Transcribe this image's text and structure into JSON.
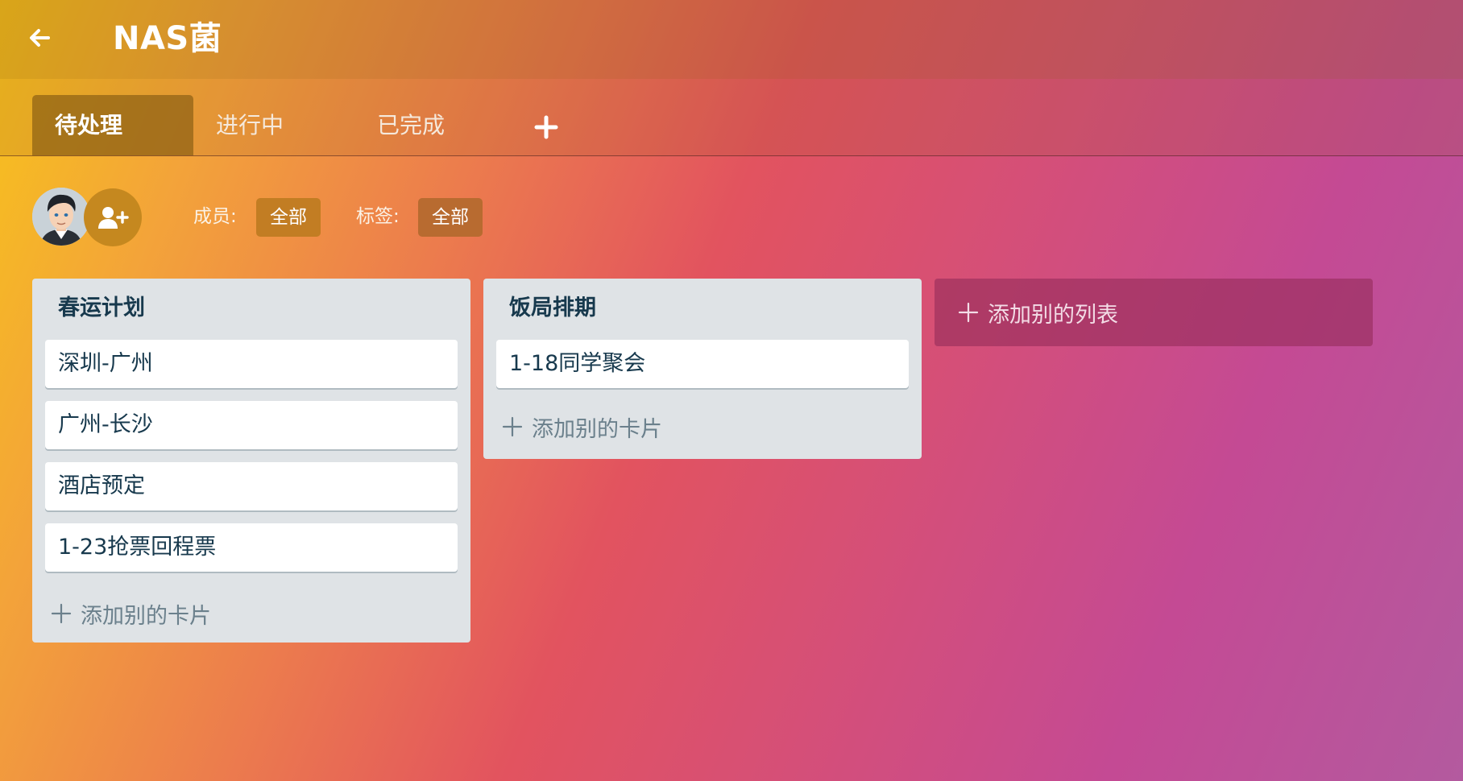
{
  "header": {
    "back_icon": "arrow-left-icon",
    "title": "NAS菌"
  },
  "tabs": [
    {
      "label": "待处理",
      "active": true
    },
    {
      "label": "进行中",
      "active": false
    },
    {
      "label": "已完成",
      "active": false
    }
  ],
  "tab_add_icon": "plus-icon",
  "filters": {
    "members_label": "成员:",
    "members_value": "全部",
    "tags_label": "标签:",
    "tags_value": "全部"
  },
  "colors": {
    "members_chip": "#c27d23",
    "tags_chip": "#b86b30",
    "list_bg": "#dfe3e6",
    "card_text": "#17394d"
  },
  "lists": [
    {
      "title": "春运计划",
      "cards": [
        "深圳-广州",
        "广州-长沙",
        "酒店预定",
        "1-23抢票回程票"
      ],
      "add_card_label": "添加别的卡片"
    },
    {
      "title": "饭局排期",
      "cards": [
        "1-18同学聚会"
      ],
      "add_card_label": "添加别的卡片"
    }
  ],
  "add_list_label": "添加别的列表"
}
